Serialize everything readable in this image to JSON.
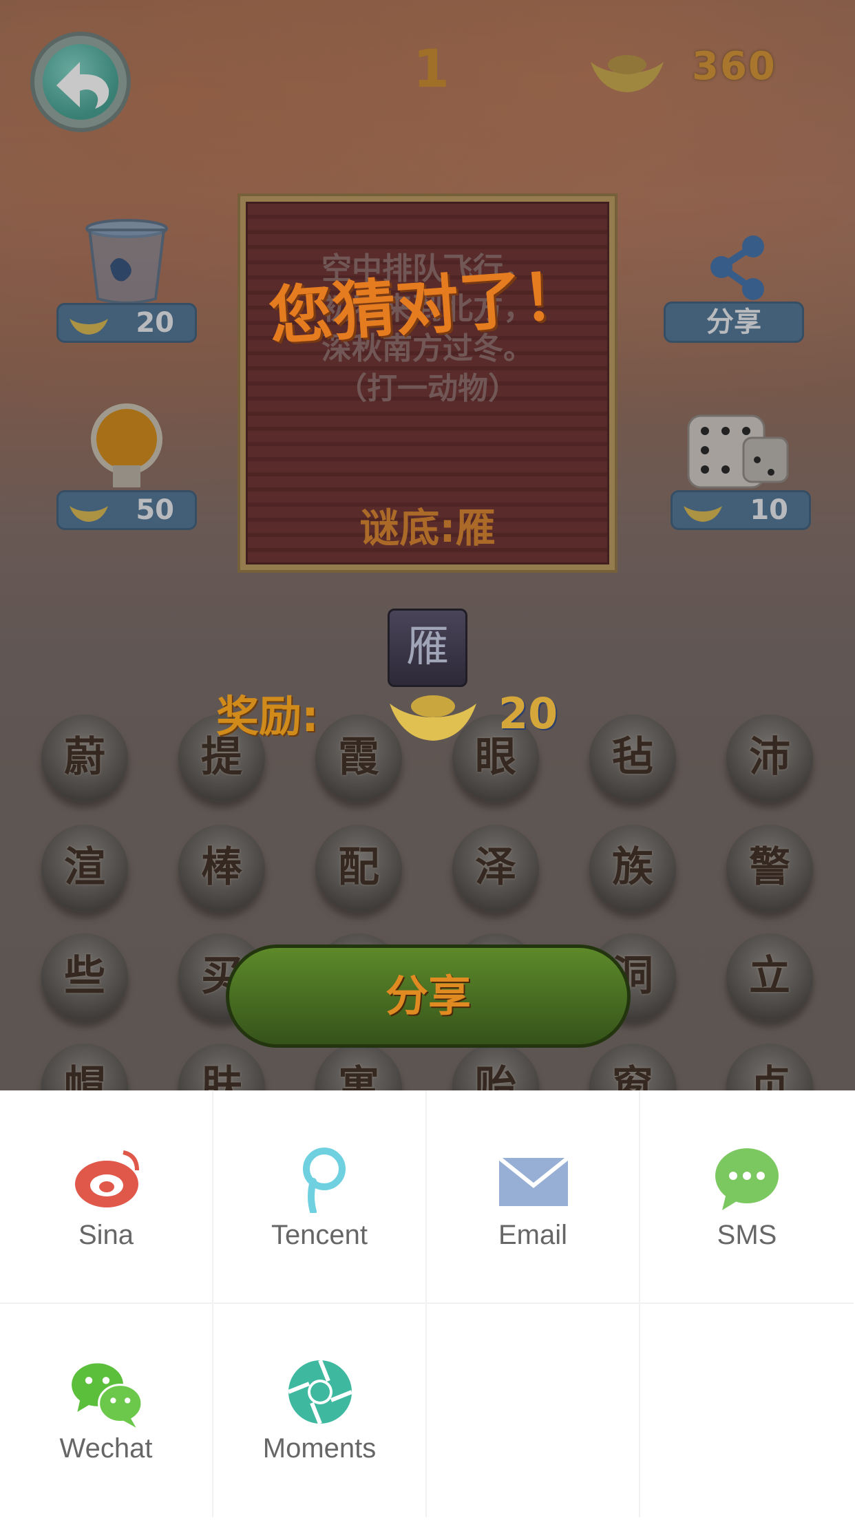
{
  "game": {
    "level": "1",
    "coins": "360",
    "tools": [
      {
        "name": "trash",
        "price": "20"
      },
      {
        "name": "bulb",
        "price": "50"
      },
      {
        "name": "dice",
        "price": "10"
      }
    ],
    "share_label": "分享",
    "riddle_lines": [
      "空中排队飞行，",
      "初春来到北方，",
      "深秋南方过冬。",
      "（打一动物）"
    ],
    "answer_text": "谜底:雁",
    "correct_text": "您猜对了！",
    "answer_tile": "雁",
    "reward_label": "奖励:",
    "reward_amount": "20",
    "letters": [
      [
        "蔚",
        "提",
        "霞",
        "眼",
        "毡",
        "沛"
      ],
      [
        "渲",
        "棒",
        "配",
        "泽",
        "族",
        "警"
      ],
      [
        "些",
        "买",
        "",
        "",
        "洞",
        "立"
      ],
      [
        "帽",
        "肤",
        "寓",
        "贻",
        "窗",
        "贞"
      ]
    ],
    "share_button": "分享"
  },
  "share_sheet": {
    "items": [
      {
        "label": "Sina",
        "icon": "sina-weibo-icon",
        "color": "#e0584a"
      },
      {
        "label": "Tencent",
        "icon": "tencent-weibo-icon",
        "color": "#6fd0e0"
      },
      {
        "label": "Email",
        "icon": "email-icon",
        "color": "#97afd4"
      },
      {
        "label": "SMS",
        "icon": "sms-icon",
        "color": "#7cc860"
      },
      {
        "label": "Wechat",
        "icon": "wechat-icon",
        "color": "#5cbf3c"
      },
      {
        "label": "Moments",
        "icon": "moments-icon",
        "color": "#3fb8a0"
      }
    ]
  }
}
